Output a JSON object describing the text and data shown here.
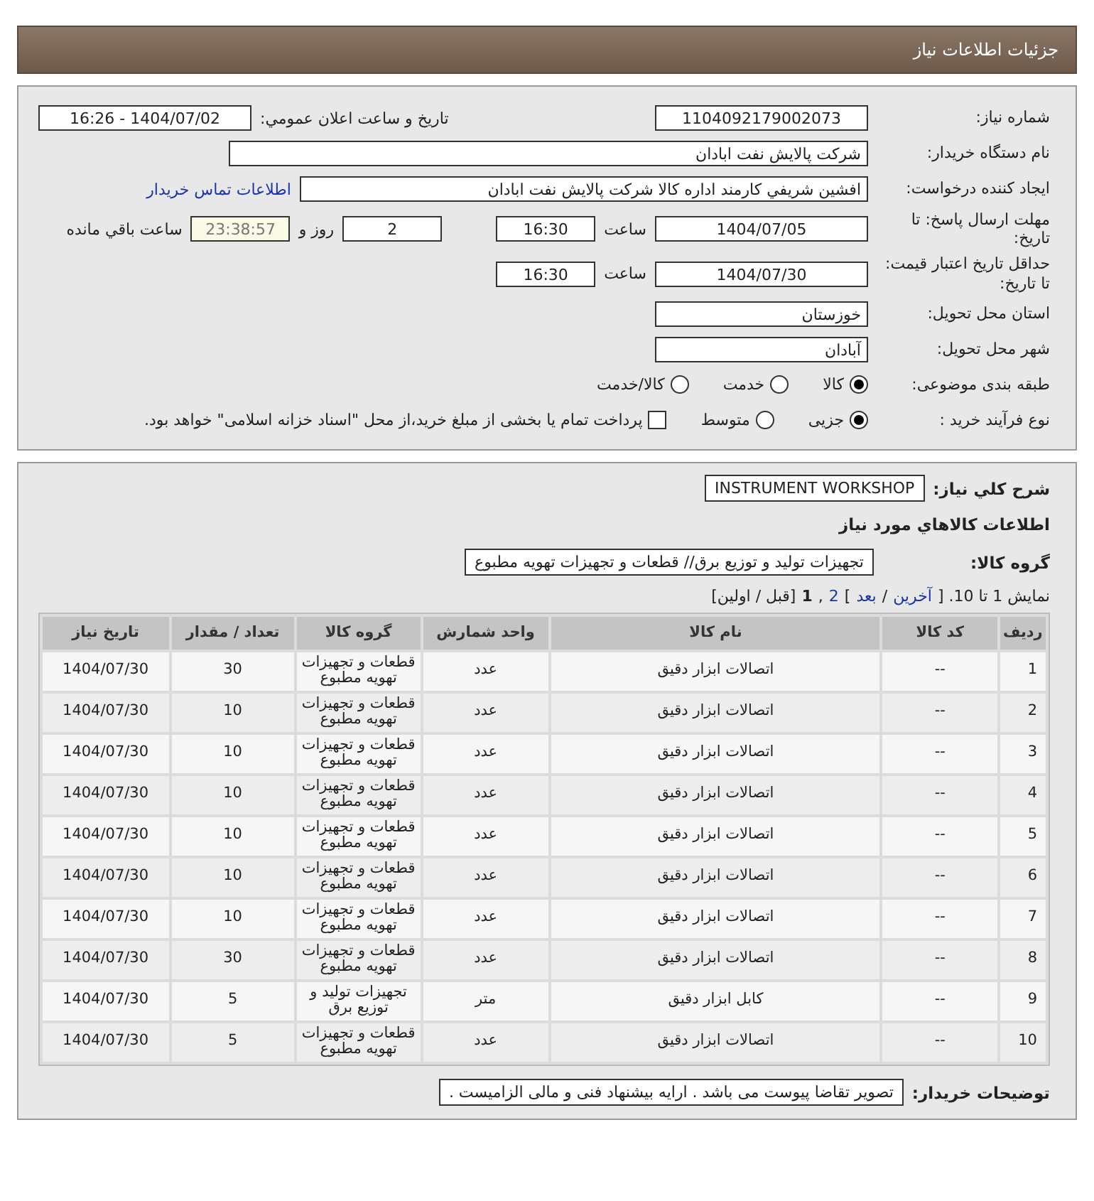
{
  "page_title": "جزئيات اطلاعات نياز",
  "need_number": {
    "label": "شماره نياز:",
    "value": "1104092179002073"
  },
  "announce": {
    "label": "تاريخ و ساعت اعلان عمومي:",
    "value": "1404/07/02 - 16:26"
  },
  "buyer": {
    "label": "نام دستگاه خريدار:",
    "value": "شرکت پالايش نفت ابادان"
  },
  "creator": {
    "label": "ايجاد کننده درخواست:",
    "value": "افشين شريفي کارمند اداره کالا  شرکت پالايش نفت ابادان",
    "contact_link": "اطلاعات تماس خريدار"
  },
  "reply_deadline": {
    "label": "مهلت ارسال پاسخ: تا تاريخ:",
    "date": "1404/07/05",
    "time_label": "ساعت",
    "time": "16:30",
    "days": "2",
    "days_label": "روز و",
    "remaining": "23:38:57",
    "remaining_label": "ساعت باقي مانده"
  },
  "price_validity": {
    "label": "حداقل تاريخ اعتبار قيمت: تا تاريخ:",
    "date": "1404/07/30",
    "time_label": "ساعت",
    "time": "16:30"
  },
  "province": {
    "label": "استان محل تحويل:",
    "value": "خوزستان"
  },
  "city": {
    "label": "شهر محل تحويل:",
    "value": "آبادان"
  },
  "category": {
    "label": "طبقه بندی موضوعی:",
    "options": [
      {
        "label": "کالا",
        "selected": true
      },
      {
        "label": "خدمت",
        "selected": false
      },
      {
        "label": "کالا/خدمت",
        "selected": false
      }
    ]
  },
  "process": {
    "label": "نوع فرآیند خرید :",
    "options": [
      {
        "label": "جزیی",
        "selected": true
      },
      {
        "label": "متوسط",
        "selected": false
      }
    ],
    "treasury": {
      "label": "پرداخت تمام یا بخشی از مبلغ خرید،از محل \"اسناد خزانه اسلامی\" خواهد بود.",
      "checked": false
    }
  },
  "summary": {
    "label": "شرح کلي نياز:",
    "value": "INSTRUMENT WORKSHOP"
  },
  "goods_heading": "اطلاعات کالاهاي مورد نياز",
  "group": {
    "label": "گروه کالا:",
    "value": "تجهیزات تولید و توزیع برق// قطعات و تجهیزات تهویه مطبوع"
  },
  "pagination": [
    {
      "kind": "text",
      "text": "نمایش 1 تا 10. ["
    },
    {
      "kind": "link",
      "text": "آخرين"
    },
    {
      "kind": "text",
      "text": "/"
    },
    {
      "kind": "link",
      "text": "بعد"
    },
    {
      "kind": "text",
      "text": "]"
    },
    {
      "kind": "link",
      "text": "2"
    },
    {
      "kind": "text",
      "text": ","
    },
    {
      "kind": "current",
      "text": "1"
    },
    {
      "kind": "text",
      "text": "[قبل / اولين]"
    }
  ],
  "table": {
    "columns": [
      "رديف",
      "کد کالا",
      "نام کالا",
      "واحد شمارش",
      "گروه کالا",
      "تعداد / مقدار",
      "تاريخ نياز"
    ],
    "rows": [
      [
        "1",
        "--",
        "اتصالات ابزار دقيق",
        "عدد",
        "قطعات و تجهيزات تهويه مطبوع",
        "30",
        "1404/07/30"
      ],
      [
        "2",
        "--",
        "اتصالات ابزار دقيق",
        "عدد",
        "قطعات و تجهيزات تهويه مطبوع",
        "10",
        "1404/07/30"
      ],
      [
        "3",
        "--",
        "اتصالات ابزار دقيق",
        "عدد",
        "قطعات و تجهيزات تهويه مطبوع",
        "10",
        "1404/07/30"
      ],
      [
        "4",
        "--",
        "اتصالات ابزار دقيق",
        "عدد",
        "قطعات و تجهيزات تهويه مطبوع",
        "10",
        "1404/07/30"
      ],
      [
        "5",
        "--",
        "اتصالات ابزار دقيق",
        "عدد",
        "قطعات و تجهيزات تهويه مطبوع",
        "10",
        "1404/07/30"
      ],
      [
        "6",
        "--",
        "اتصالات ابزار دقيق",
        "عدد",
        "قطعات و تجهيزات تهويه مطبوع",
        "10",
        "1404/07/30"
      ],
      [
        "7",
        "--",
        "اتصالات ابزار دقيق",
        "عدد",
        "قطعات و تجهيزات تهويه مطبوع",
        "10",
        "1404/07/30"
      ],
      [
        "8",
        "--",
        "اتصالات ابزار دقيق",
        "عدد",
        "قطعات و تجهيزات تهويه مطبوع",
        "30",
        "1404/07/30"
      ],
      [
        "9",
        "--",
        "کابل ابزار دقيق",
        "متر",
        "تجهيزات توليد و توزيع برق",
        "5",
        "1404/07/30"
      ],
      [
        "10",
        "--",
        "اتصالات ابزار دقيق",
        "عدد",
        "قطعات و تجهيزات تهويه مطبوع",
        "5",
        "1404/07/30"
      ]
    ]
  },
  "buyer_notes": {
    "label": "توضيحات خريدار:",
    "value": "تصویر تقاضا پیوست می باشد . ارایه بیشنهاد فنی و مالی الزامیست ."
  }
}
